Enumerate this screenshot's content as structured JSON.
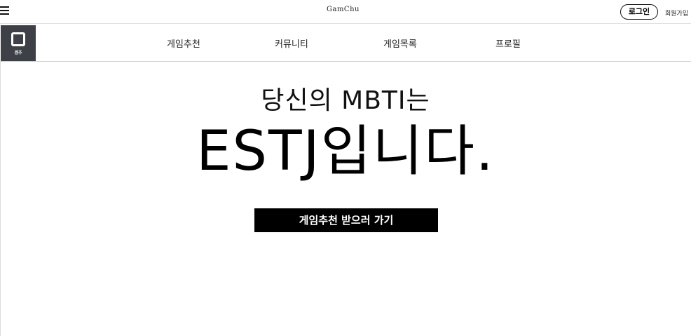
{
  "header": {
    "logo_text": "GamChu",
    "login_label": "로그인",
    "signup_label": "회원가입"
  },
  "navbar": {
    "side_logo_label": "겜추",
    "items": [
      {
        "label": "게임추천"
      },
      {
        "label": "커뮤니티"
      },
      {
        "label": "게임목록"
      },
      {
        "label": "프로필"
      }
    ]
  },
  "main": {
    "headline_line1": "당신의 MBTI는",
    "headline_line2": "ESTJ입니다.",
    "cta_label": "게임추천 받으러 가기"
  },
  "icons": {
    "menu": "hamburger-menu-icon",
    "side_logo": "rounded-square-logo-icon"
  }
}
